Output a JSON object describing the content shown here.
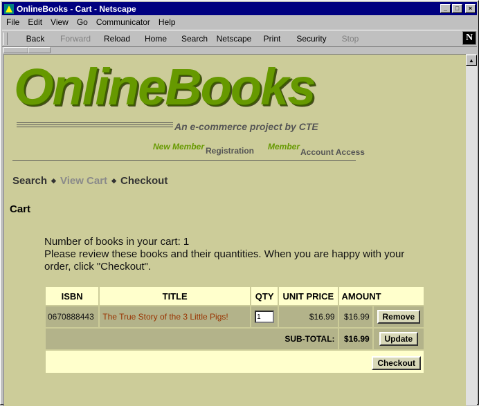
{
  "window": {
    "title": "OnlineBooks - Cart - Netscape"
  },
  "menu": [
    "File",
    "Edit",
    "View",
    "Go",
    "Communicator",
    "Help"
  ],
  "toolbar": [
    {
      "label": "Back",
      "enabled": true
    },
    {
      "label": "Forward",
      "enabled": false
    },
    {
      "label": "Reload",
      "enabled": true
    },
    {
      "label": "Home",
      "enabled": true
    },
    {
      "label": "Search",
      "enabled": true
    },
    {
      "label": "Netscape",
      "enabled": true
    },
    {
      "label": "Print",
      "enabled": true
    },
    {
      "label": "Security",
      "enabled": true
    },
    {
      "label": "Stop",
      "enabled": false
    }
  ],
  "logo": {
    "text": "OnlineBooks",
    "tagline": "An e-commerce project by CTE"
  },
  "member_nav": {
    "new_member": "New Member",
    "registration": "Registration",
    "member": "Member",
    "account_access": "Account Access"
  },
  "crumbs": {
    "search": "Search",
    "view_cart": "View Cart",
    "checkout": "Checkout"
  },
  "heading": "Cart",
  "summary": {
    "line1": "Number of books in your cart: 1",
    "line2": "Please review these books and their quantities. When you are happy with your order, click \"Checkout\"."
  },
  "table": {
    "headers": [
      "ISBN",
      "TITLE",
      "QTY",
      "UNIT PRICE",
      "AMOUNT"
    ],
    "rows": [
      {
        "isbn": "0670888443",
        "title": "The True Story of the 3 Little Pigs!",
        "qty": "1",
        "unit_price": "$16.99",
        "amount": "$16.99",
        "remove_label": "Remove"
      }
    ],
    "subtotal_label": "SUB-TOTAL:",
    "subtotal_value": "$16.99",
    "update_label": "Update",
    "checkout_label": "Checkout"
  },
  "colors": {
    "page_bg": "#cccc99",
    "logo_green": "#669900",
    "link_title": "#993300",
    "cell_light": "#ffffcc",
    "cell_dark": "#b3b38a"
  }
}
